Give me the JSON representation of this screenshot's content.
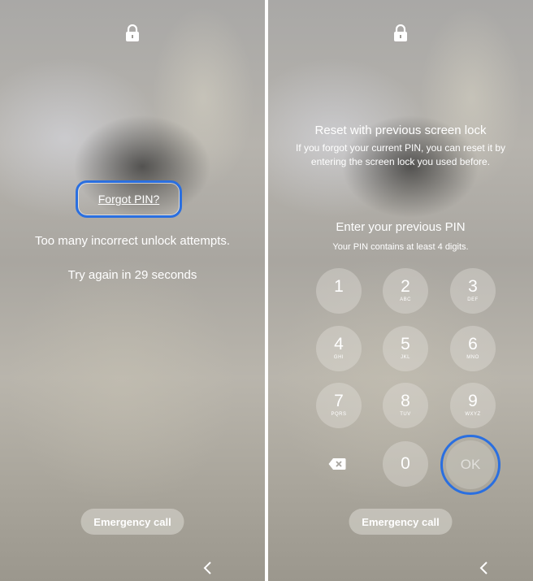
{
  "left": {
    "forgot_pin": "Forgot PIN?",
    "message": "Too many incorrect unlock attempts.",
    "retry": "Try again in 29 seconds",
    "emergency": "Emergency call"
  },
  "right": {
    "reset_title": "Reset with previous screen lock",
    "reset_desc_line1": "If you forgot your current PIN, you can reset it by",
    "reset_desc_line2": "entering the screen lock you used before.",
    "prompt": "Enter your previous PIN",
    "hint": "Your PIN contains at least 4 digits.",
    "keys": [
      {
        "num": "1",
        "letters": ""
      },
      {
        "num": "2",
        "letters": "ABC"
      },
      {
        "num": "3",
        "letters": "DEF"
      },
      {
        "num": "4",
        "letters": "GHI"
      },
      {
        "num": "5",
        "letters": "JKL"
      },
      {
        "num": "6",
        "letters": "MNO"
      },
      {
        "num": "7",
        "letters": "PQRS"
      },
      {
        "num": "8",
        "letters": "TUV"
      },
      {
        "num": "9",
        "letters": "WXYZ"
      }
    ],
    "zero": "0",
    "ok": "OK",
    "emergency": "Emergency call"
  },
  "colors": {
    "highlight": "#2a6fe0",
    "text": "#ffffff"
  }
}
